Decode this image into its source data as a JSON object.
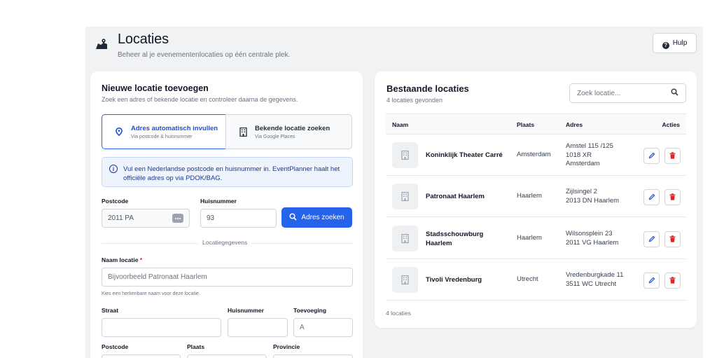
{
  "header": {
    "title": "Locaties",
    "subtitle": "Beheer al je evenementenlocaties op één centrale plek.",
    "help_label": "Hulp"
  },
  "new_location": {
    "title": "Nieuwe locatie toevoegen",
    "subtitle": "Zoek een adres of bekende locatie en controleer daarna de gegevens.",
    "option_auto": {
      "label": "Adres automatisch invullen",
      "sub": "Via postcode & huisnummer"
    },
    "option_known": {
      "label": "Bekende locatie zoeken",
      "sub": "Via Google Places"
    },
    "info": "Vul een Nederlandse postcode en huisnummer in. EventPlanner haalt het officiële adres op via PDOK/BAG.",
    "postcode_label": "Postcode",
    "postcode_value": "2011 PA",
    "housenumber_label": "Huisnummer",
    "housenumber_value": "93",
    "search_button": "Adres zoeken",
    "section_label": "Locatiegegevens",
    "name_label": "Naam locatie",
    "name_required": "*",
    "name_placeholder": "Bijvoorbeeld Patronaat Haarlem",
    "name_hint": "Kies een herkenbare naam voor deze locatie.",
    "street_label": "Straat",
    "street_value": "",
    "housenumber2_label": "Huisnummer",
    "housenumber2_value": "",
    "addition_label": "Toevoeging",
    "addition_placeholder": "A",
    "postcode2_label": "Postcode",
    "city_label": "Plaats",
    "province_label": "Provincie"
  },
  "existing": {
    "title": "Bestaande locaties",
    "count_text": "4 locaties gevonden",
    "search_placeholder": "Zoek locatie...",
    "columns": {
      "name": "Naam",
      "place": "Plaats",
      "address": "Adres",
      "actions": "Acties"
    },
    "rows": [
      {
        "name": "Koninklijk Theater Carré",
        "place": "Amsterdam",
        "address": "Amstel 115 /125\n1018 XR\nAmsterdam"
      },
      {
        "name": "Patronaat Haarlem",
        "place": "Haarlem",
        "address": "Zijlsingel 2\n2013 DN Haarlem"
      },
      {
        "name": "Stadsschouwburg\nHaarlem",
        "place": "Haarlem",
        "address": "Wilsonsplein 23\n2011 VG Haarlem"
      },
      {
        "name": "Tivoli Vredenburg",
        "place": "Utrecht",
        "address": "Vredenburgkade 11\n3511 WC Utrecht"
      }
    ],
    "footer_count": "4 locaties"
  },
  "colors": {
    "primary": "#2563eb",
    "danger": "#dc2626",
    "background": "#f1f2f4"
  }
}
